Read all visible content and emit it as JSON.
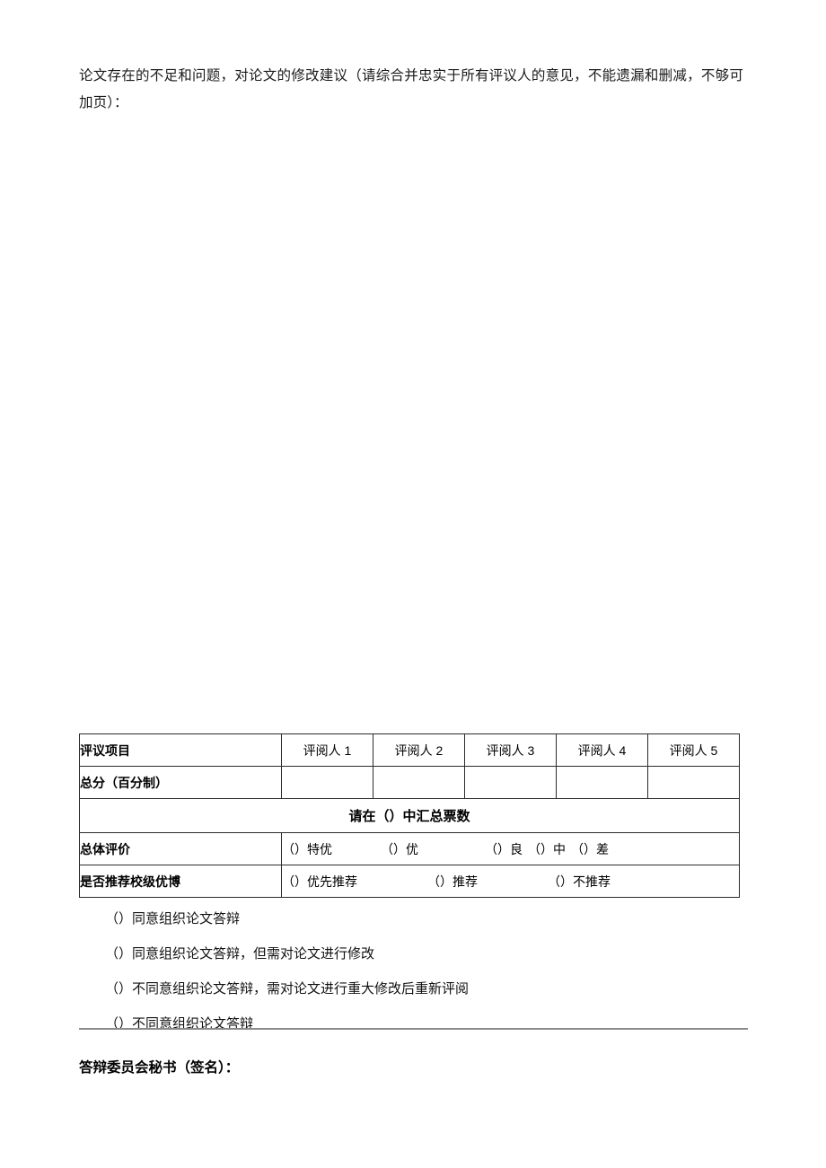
{
  "document": {
    "prompt": "论文存在的不足和问题，对论文的修改建议（请综合并忠实于所有评议人的意见，不能遗漏和删减，不够可加页）："
  },
  "table": {
    "header": {
      "item_label": "评议项目",
      "reviewers": [
        "评阅人 1",
        "评阅人 2",
        "评阅人 3",
        "评阅人 4",
        "评阅人 5"
      ]
    },
    "score_row": {
      "label": "总分（百分制）",
      "values": [
        "",
        "",
        "",
        "",
        ""
      ]
    },
    "tally_note": "请在（）中汇总票数",
    "overall_row": {
      "label": "总体评价",
      "options": [
        "（）特优",
        "（）优",
        "（）良",
        "（）中",
        "（）差"
      ]
    },
    "recommend_row": {
      "label": "是否推荐校级优博",
      "options": [
        "（）优先推荐",
        "（）推荐",
        "（）不推荐"
      ]
    }
  },
  "decisions": [
    "（）同意组织论文答辩",
    "（）同意组织论文答辩，但需对论文进行修改",
    "（）不同意组织论文答辩，需对论文进行重大修改后重新评阅",
    "（）不同意组织论文答辩"
  ],
  "footer": {
    "signature_label": "答辩委员会秘书（签名）："
  },
  "colors": {
    "text": "#000000",
    "border": "#2b2b2b",
    "rule": "#8a8a8a",
    "background": "#ffffff"
  }
}
